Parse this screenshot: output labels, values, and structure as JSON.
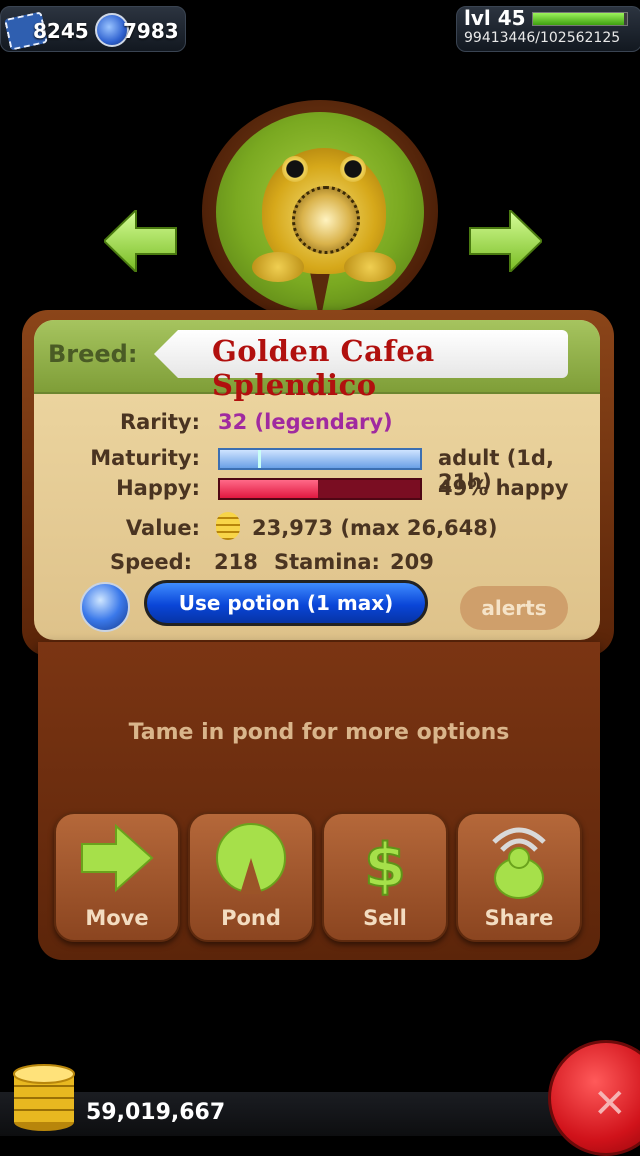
{
  "top_bar": {
    "tickets": "8245",
    "potions": "7983",
    "level": "lvl 45",
    "xp": "99413446/102562125",
    "xp_fraction": 0.97
  },
  "frog": {
    "icon": "golden-frog",
    "prev_icon": "left-arrow",
    "next_icon": "right-arrow"
  },
  "info": {
    "breed_label": "Breed:",
    "breed_name": "Golden Cafea Splendico",
    "rarity_label": "Rarity:",
    "rarity_value": "32 (legendary)",
    "maturity_label": "Maturity:",
    "maturity_value": "adult (1d, 21h)",
    "happy_label": "Happy:",
    "happy_value": "49% happy",
    "happy_fraction": 0.49,
    "value_label": "Value:",
    "value_value": "23,973 (max 26,648)",
    "speed_label": "Speed:",
    "speed_value": "218",
    "stamina_label": "Stamina:",
    "stamina_value": "209",
    "potion_button": "Use potion (1 max)",
    "alerts_button": "alerts"
  },
  "lower": {
    "tame_message": "Tame in pond for more options",
    "actions": [
      {
        "label": "Move",
        "icon": "arrow-icon"
      },
      {
        "label": "Pond",
        "icon": "lilypad-icon"
      },
      {
        "label": "Sell",
        "icon": "dollar-icon"
      },
      {
        "label": "Share",
        "icon": "share-frog-icon"
      }
    ]
  },
  "bottom": {
    "coins": "59,019,667"
  },
  "colors": {
    "accent_green": "#9cd84a",
    "rarity": "#a02aa0",
    "breed_name": "#b1100e",
    "potion_button": "#0a46d8"
  }
}
